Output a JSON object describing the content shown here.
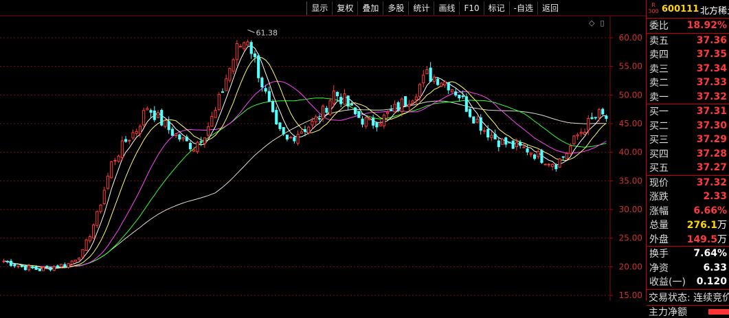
{
  "toolbar": {
    "items": [
      "显示",
      "复权",
      "叠加",
      "多股",
      "统计",
      "画线",
      "F10",
      "标记",
      "-自选",
      "返回"
    ]
  },
  "header": {
    "badge": "R 300",
    "code": "600111",
    "name": "北方稀土"
  },
  "chart_icons": {
    "diamond": "◇",
    "square": "▯"
  },
  "quote": {
    "weibi_label": "委比",
    "weibi_value": "18.92%",
    "asks": [
      {
        "label": "卖五",
        "price": "37.36"
      },
      {
        "label": "卖四",
        "price": "37.35"
      },
      {
        "label": "卖三",
        "price": "37.34"
      },
      {
        "label": "卖二",
        "price": "37.33"
      },
      {
        "label": "卖一",
        "price": "37.32"
      }
    ],
    "bids": [
      {
        "label": "买一",
        "price": "37.31"
      },
      {
        "label": "买二",
        "price": "37.30"
      },
      {
        "label": "买三",
        "price": "37.29"
      },
      {
        "label": "买四",
        "price": "37.28"
      },
      {
        "label": "买五",
        "price": "37.27"
      }
    ],
    "stats": [
      {
        "label": "现价",
        "value": "37.32",
        "unit": ""
      },
      {
        "label": "涨跌",
        "value": "2.33",
        "unit": ""
      },
      {
        "label": "涨幅",
        "value": "6.66%",
        "unit": ""
      },
      {
        "label": "总量",
        "value": "276.1",
        "unit": "万"
      },
      {
        "label": "外盘",
        "value": "149.5",
        "unit": "万"
      }
    ],
    "extra": [
      {
        "label": "换手",
        "value": "7.64%"
      },
      {
        "label": "净资",
        "value": "6.33"
      },
      {
        "label": "收益(一)",
        "value": "0.120"
      }
    ],
    "status_text": "交易状态: 连续竞价",
    "mainflow_text": "主力净额"
  },
  "colors": {
    "up": "#ff3b3b",
    "down": "#54ffff",
    "ma5": "#ffffff",
    "ma10": "#ffff66",
    "ma20": "#ff44ff",
    "ma30": "#33ff33",
    "ma60": "#ddddcc",
    "grid": "#7a1010"
  },
  "chart_data": {
    "type": "candlestick",
    "y_ticks": [
      "60.00",
      "55.00",
      "50.00",
      "45.00",
      "40.00",
      "35.00",
      "30.00",
      "25.00",
      "20.00",
      "15.00"
    ],
    "ylim": [
      15,
      62
    ],
    "annotation": "61.38",
    "key_points": [
      [
        0,
        21
      ],
      [
        5,
        20
      ],
      [
        10,
        19.5
      ],
      [
        18,
        20.5
      ],
      [
        22,
        22.5
      ],
      [
        26,
        29
      ],
      [
        30,
        38
      ],
      [
        34,
        42
      ],
      [
        37,
        44
      ],
      [
        40,
        48
      ],
      [
        43,
        46
      ],
      [
        46,
        44
      ],
      [
        50,
        42
      ],
      [
        53,
        41
      ],
      [
        56,
        43.5
      ],
      [
        59,
        47
      ],
      [
        62,
        53
      ],
      [
        65,
        58
      ],
      [
        68,
        60
      ],
      [
        70,
        56
      ],
      [
        73,
        50
      ],
      [
        76,
        44
      ],
      [
        79,
        42
      ],
      [
        82,
        43.5
      ],
      [
        86,
        45
      ],
      [
        89,
        47
      ],
      [
        92,
        50.5
      ],
      [
        95,
        49
      ],
      [
        98,
        46.5
      ],
      [
        102,
        45
      ],
      [
        106,
        46
      ],
      [
        110,
        48
      ],
      [
        114,
        50
      ],
      [
        118,
        53.5
      ],
      [
        121,
        53
      ],
      [
        124,
        52
      ],
      [
        127,
        50
      ],
      [
        130,
        47
      ],
      [
        134,
        44
      ],
      [
        138,
        42
      ],
      [
        142,
        41
      ],
      [
        146,
        40.5
      ],
      [
        150,
        39
      ],
      [
        154,
        38
      ],
      [
        157,
        40
      ],
      [
        160,
        43
      ],
      [
        163,
        45
      ],
      [
        166,
        46.5
      ],
      [
        168,
        46
      ]
    ],
    "n_bars": 169
  }
}
